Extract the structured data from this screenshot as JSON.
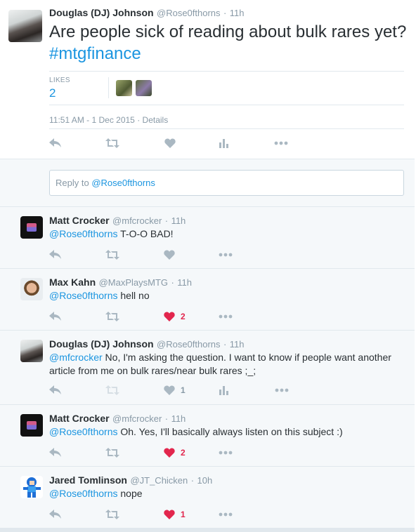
{
  "tweet": {
    "author_name": "Douglas (DJ) Johnson",
    "author_handle": "@Rose0fthorns",
    "separator": "·",
    "time_ago": "11h",
    "text_plain": "Are people sick of reading about bulk rares yet? ",
    "hashtag": "#mtgfinance",
    "likes_label": "LIKES",
    "likes_count": "2",
    "timestamp": "11:51 AM - 1 Dec 2015",
    "details_link": "Details"
  },
  "reply_box": {
    "prefix": "Reply to ",
    "mention": "@Rose0fthorns"
  },
  "replies": [
    {
      "name": "Matt Crocker",
      "handle": "@mfcrocker",
      "time": "11h",
      "mention": "@Rose0fthorns",
      "text": " T-O-O BAD!",
      "like_count": "",
      "liked": false,
      "has_analytics": false
    },
    {
      "name": "Max Kahn",
      "handle": "@MaxPlaysMTG",
      "time": "11h",
      "mention": "@Rose0fthorns",
      "text": " hell no",
      "like_count": "2",
      "liked": true,
      "has_analytics": false
    },
    {
      "name": "Douglas (DJ) Johnson",
      "handle": "@Rose0fthorns",
      "time": "11h",
      "mention": "@mfcrocker",
      "text": " No, I'm asking the question. I want to know if people want another article from me on bulk rares/near bulk rares ;_;",
      "like_count": "1",
      "liked": false,
      "has_analytics": true
    },
    {
      "name": "Matt Crocker",
      "handle": "@mfcrocker",
      "time": "11h",
      "mention": "@Rose0fthorns",
      "text": " Oh. Yes, I'll basically always listen on this subject :)",
      "like_count": "2",
      "liked": true,
      "has_analytics": false
    },
    {
      "name": "Jared Tomlinson",
      "handle": "@JT_Chicken",
      "time": "10h",
      "mention": "@Rose0fthorns",
      "text": " nope",
      "like_count": "1",
      "liked": true,
      "has_analytics": false
    }
  ],
  "icons": [
    "reply-icon",
    "retweet-icon",
    "heart-icon",
    "analytics-icon",
    "more-icon"
  ],
  "colors": {
    "link": "#1b95e0",
    "liked": "#e2264d",
    "muted": "#8899a6",
    "icon": "#aab8c2",
    "reply_bg": "#f5f8fa"
  }
}
